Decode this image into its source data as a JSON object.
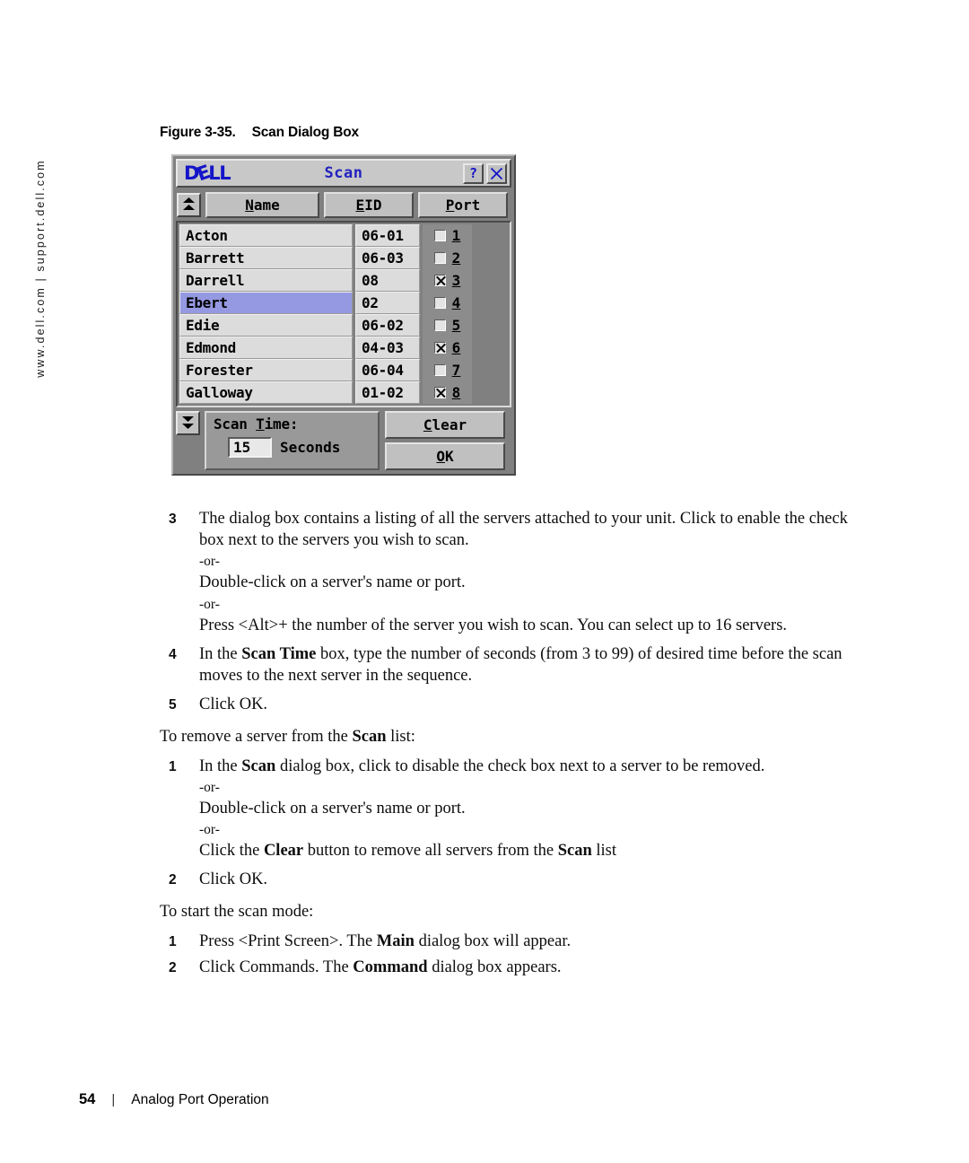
{
  "side_note": "www.dell.com | support.dell.com",
  "figure": {
    "number": "Figure 3-35.",
    "title": "Scan Dialog Box"
  },
  "dialog": {
    "brand": "DELL",
    "title": "Scan",
    "help_button": "?",
    "close_button": "close-icon",
    "scroll_up": "scroll-up-icon",
    "scroll_down": "scroll-down-icon",
    "columns": [
      {
        "label": "Name",
        "mnemonic": "N"
      },
      {
        "label": "EID",
        "mnemonic": "E"
      },
      {
        "label": "Port",
        "mnemonic": "P"
      }
    ],
    "rows": [
      {
        "name": "Acton",
        "eid": "06-01",
        "checked": false,
        "number": "1",
        "selected": false
      },
      {
        "name": "Barrett",
        "eid": "06-03",
        "checked": false,
        "number": "2",
        "selected": false
      },
      {
        "name": "Darrell",
        "eid": "08",
        "checked": true,
        "number": "3",
        "selected": false
      },
      {
        "name": "Ebert",
        "eid": "02",
        "checked": false,
        "number": "4",
        "selected": true
      },
      {
        "name": "Edie",
        "eid": "06-02",
        "checked": false,
        "number": "5",
        "selected": false
      },
      {
        "name": "Edmond",
        "eid": "04-03",
        "checked": true,
        "number": "6",
        "selected": false
      },
      {
        "name": "Forester",
        "eid": "06-04",
        "checked": false,
        "number": "7",
        "selected": false
      },
      {
        "name": "Galloway",
        "eid": "01-02",
        "checked": true,
        "number": "8",
        "selected": false
      }
    ],
    "scan_time_label": "Scan Time:",
    "scan_time_value": "15",
    "scan_time_units": "Seconds",
    "clear_button": "Clear",
    "ok_button": "OK",
    "colors": {
      "selection": "#9599e2",
      "title_text": "#2222c0",
      "logo": "#1414c8",
      "face": "#c0c0c0"
    }
  },
  "body": {
    "step3_num": "3",
    "step3_text": "The dialog box contains a listing of all the servers attached to your unit. Click to enable the check box next to the servers you wish to scan.",
    "or1": "-or-",
    "step3_alt1": "Double-click on a server's name or port.",
    "or2": "-or-",
    "step3_alt2": "Press <Alt>+ the number of the server you wish to scan. You can select up to 16 servers.",
    "step4_num": "4",
    "step4_a": "In the ",
    "step4_b": "Scan Time",
    "step4_c": " box, type the number of seconds (from 3 to 99) of desired time before the scan moves to the next server in the sequence.",
    "step5_num": "5",
    "step5_text": "Click OK.",
    "lead1_a": "To remove a server from the ",
    "lead1_b": "Scan",
    "lead1_c": " list:",
    "r1_num": "1",
    "r1_a": "In the ",
    "r1_b": "Scan",
    "r1_c": " dialog box, click to disable the check box next to a server to be removed.",
    "or3": "-or-",
    "r1_alt1": "Double-click on a server's name or port.",
    "or4": "-or-",
    "r1_alt2_a": "Click the ",
    "r1_alt2_b": "Clear",
    "r1_alt2_c": " button to remove all servers from the ",
    "r1_alt2_d": "Scan",
    "r1_alt2_e": " list",
    "r2_num": "2",
    "r2_text": "Click OK.",
    "lead2": "To start the scan mode:",
    "s1_num": "1",
    "s1_a": "Press <Print Screen>. The ",
    "s1_b": "Main",
    "s1_c": " dialog box will appear.",
    "s2_num": "2",
    "s2_a": "Click Commands. The ",
    "s2_b": "Command",
    "s2_c": " dialog box appears."
  },
  "footer": {
    "page_number": "54",
    "separator": "|",
    "section": "Analog Port Operation"
  }
}
